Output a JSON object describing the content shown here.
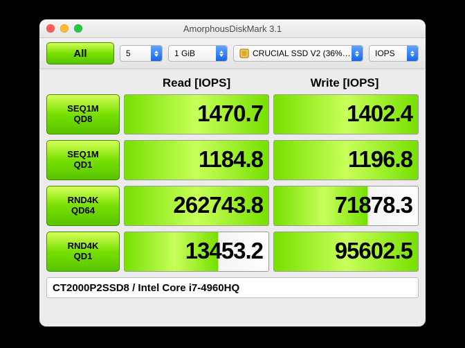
{
  "window": {
    "title": "AmorphousDiskMark 3.1"
  },
  "toolbar": {
    "all_label": "All",
    "runs": "5",
    "size": "1 GiB",
    "disk": "CRUCIAL SSD V2 (36%…",
    "unit": "IOPS"
  },
  "headers": {
    "read": "Read [IOPS]",
    "write": "Write [IOPS]"
  },
  "rows": [
    {
      "l1": "SEQ1M",
      "l2": "QD8",
      "read": "1470.7",
      "write": "1402.4",
      "rfill": "full",
      "wfill": "full"
    },
    {
      "l1": "SEQ1M",
      "l2": "QD1",
      "read": "1184.8",
      "write": "1196.8",
      "rfill": "full",
      "wfill": "full"
    },
    {
      "l1": "RND4K",
      "l2": "QD64",
      "read": "262743.8",
      "write": "71878.3",
      "rfill": "full",
      "wfill": "partial"
    },
    {
      "l1": "RND4K",
      "l2": "QD1",
      "read": "13453.2",
      "write": "95602.5",
      "rfill": "partial",
      "wfill": "full"
    }
  ],
  "footer": {
    "text": "CT2000P2SSD8 / Intel Core i7-4960HQ"
  }
}
